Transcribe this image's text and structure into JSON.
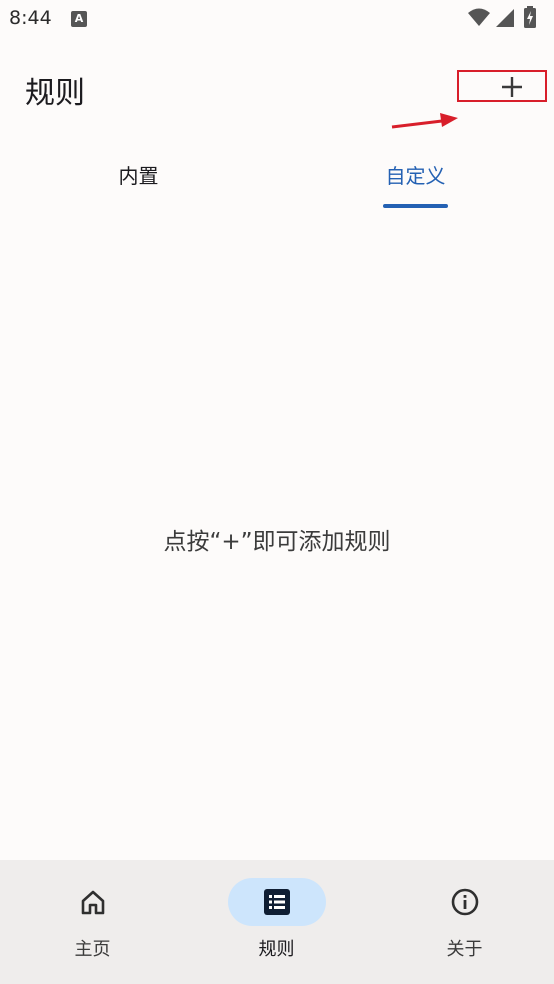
{
  "status_bar": {
    "time": "8:44",
    "notification_icon_letter": "A",
    "icons": [
      "wifi-icon",
      "signal-icon",
      "battery-charging-icon"
    ]
  },
  "app_bar": {
    "title": "规则",
    "add_icon": "plus-icon",
    "annotation": {
      "arrow_color": "#d81e2a",
      "highlight_color": "#d81e2a"
    }
  },
  "tabs": [
    {
      "label": "内置",
      "selected": false
    },
    {
      "label": "自定义",
      "selected": true
    }
  ],
  "empty_state": {
    "message": "点按“+”即可添加规则"
  },
  "bottom_nav": [
    {
      "label": "主页",
      "icon": "home-icon",
      "active": false
    },
    {
      "label": "规则",
      "icon": "list-icon",
      "active": true
    },
    {
      "label": "关于",
      "icon": "info-icon",
      "active": false
    }
  ],
  "colors": {
    "accent": "#2461b3",
    "active_nav_bg": "#cde5fc",
    "background": "#fdfbfa",
    "nav_bg": "#efedec"
  }
}
